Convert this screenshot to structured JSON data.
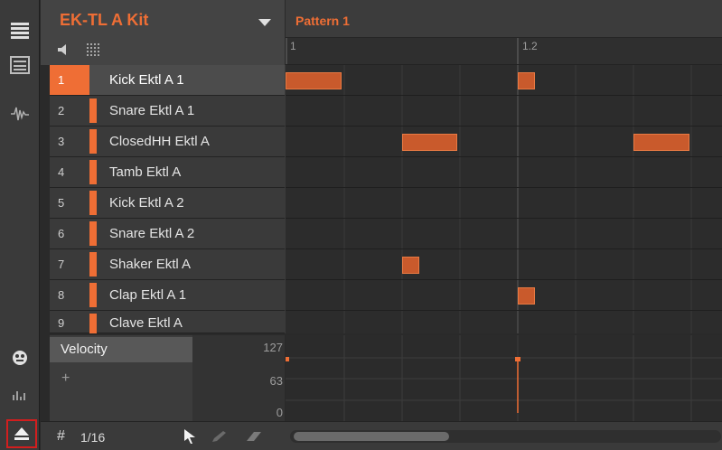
{
  "group": {
    "kit_name": "EK-TL A Kit"
  },
  "pattern": {
    "name": "Pattern 1",
    "markers": [
      "1",
      "1.2"
    ]
  },
  "sounds": [
    {
      "number": "1",
      "name": "Kick Ektl A 1",
      "selected": true
    },
    {
      "number": "2",
      "name": "Snare Ektl A 1",
      "selected": false
    },
    {
      "number": "3",
      "name": "ClosedHH Ektl A",
      "selected": false
    },
    {
      "number": "4",
      "name": "Tamb Ektl A",
      "selected": false
    },
    {
      "number": "5",
      "name": "Kick Ektl A 2",
      "selected": false
    },
    {
      "number": "6",
      "name": "Snare Ektl A 2",
      "selected": false
    },
    {
      "number": "7",
      "name": "Shaker Ektl A",
      "selected": false
    },
    {
      "number": "8",
      "name": "Clap Ektl A 1",
      "selected": false
    },
    {
      "number": "9",
      "name": "Clave Ektl A",
      "selected": false
    }
  ],
  "modulation": {
    "label": "Velocity",
    "add_symbol": "+",
    "scale": [
      "127",
      "63",
      "0"
    ]
  },
  "footer": {
    "step_symbol": "#",
    "step_size": "1/16"
  },
  "colors": {
    "accent": "#ef6e35",
    "note_fill": "#c95a2c",
    "highlight_frame": "#d21e1e"
  }
}
